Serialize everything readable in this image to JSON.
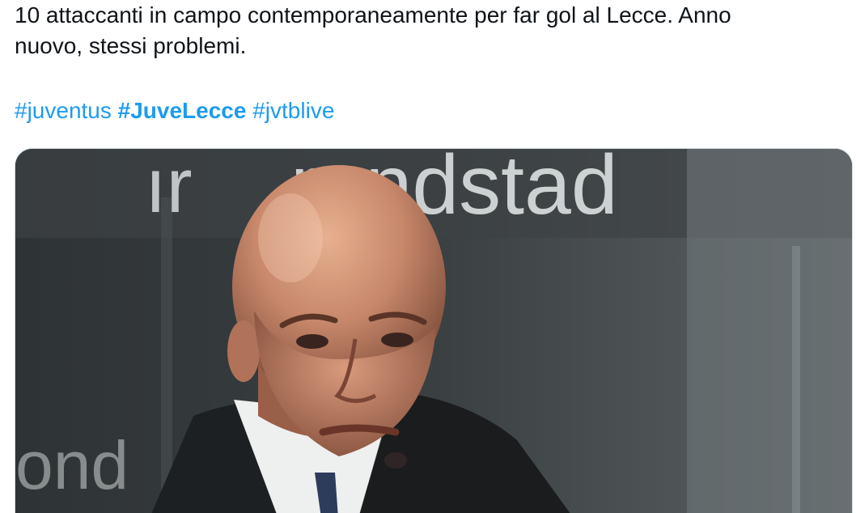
{
  "tweet": {
    "text_line1": "10 attaccanti in campo contemporaneamente per far gol al Lecce. Anno",
    "text_line2": "nuovo, stessi problemi.",
    "hashtags": [
      {
        "label": "#juventus",
        "bold": false
      },
      {
        "label": "#JuveLecce",
        "bold": true
      },
      {
        "label": "#jvtblive",
        "bold": false
      }
    ],
    "link_color": "#1d9bf0",
    "text_color": "#0f1419"
  },
  "media": {
    "type": "video-still",
    "background_sign_text": "randstad",
    "background_sign_partial": "ır",
    "background_sign_lower": "ond"
  }
}
